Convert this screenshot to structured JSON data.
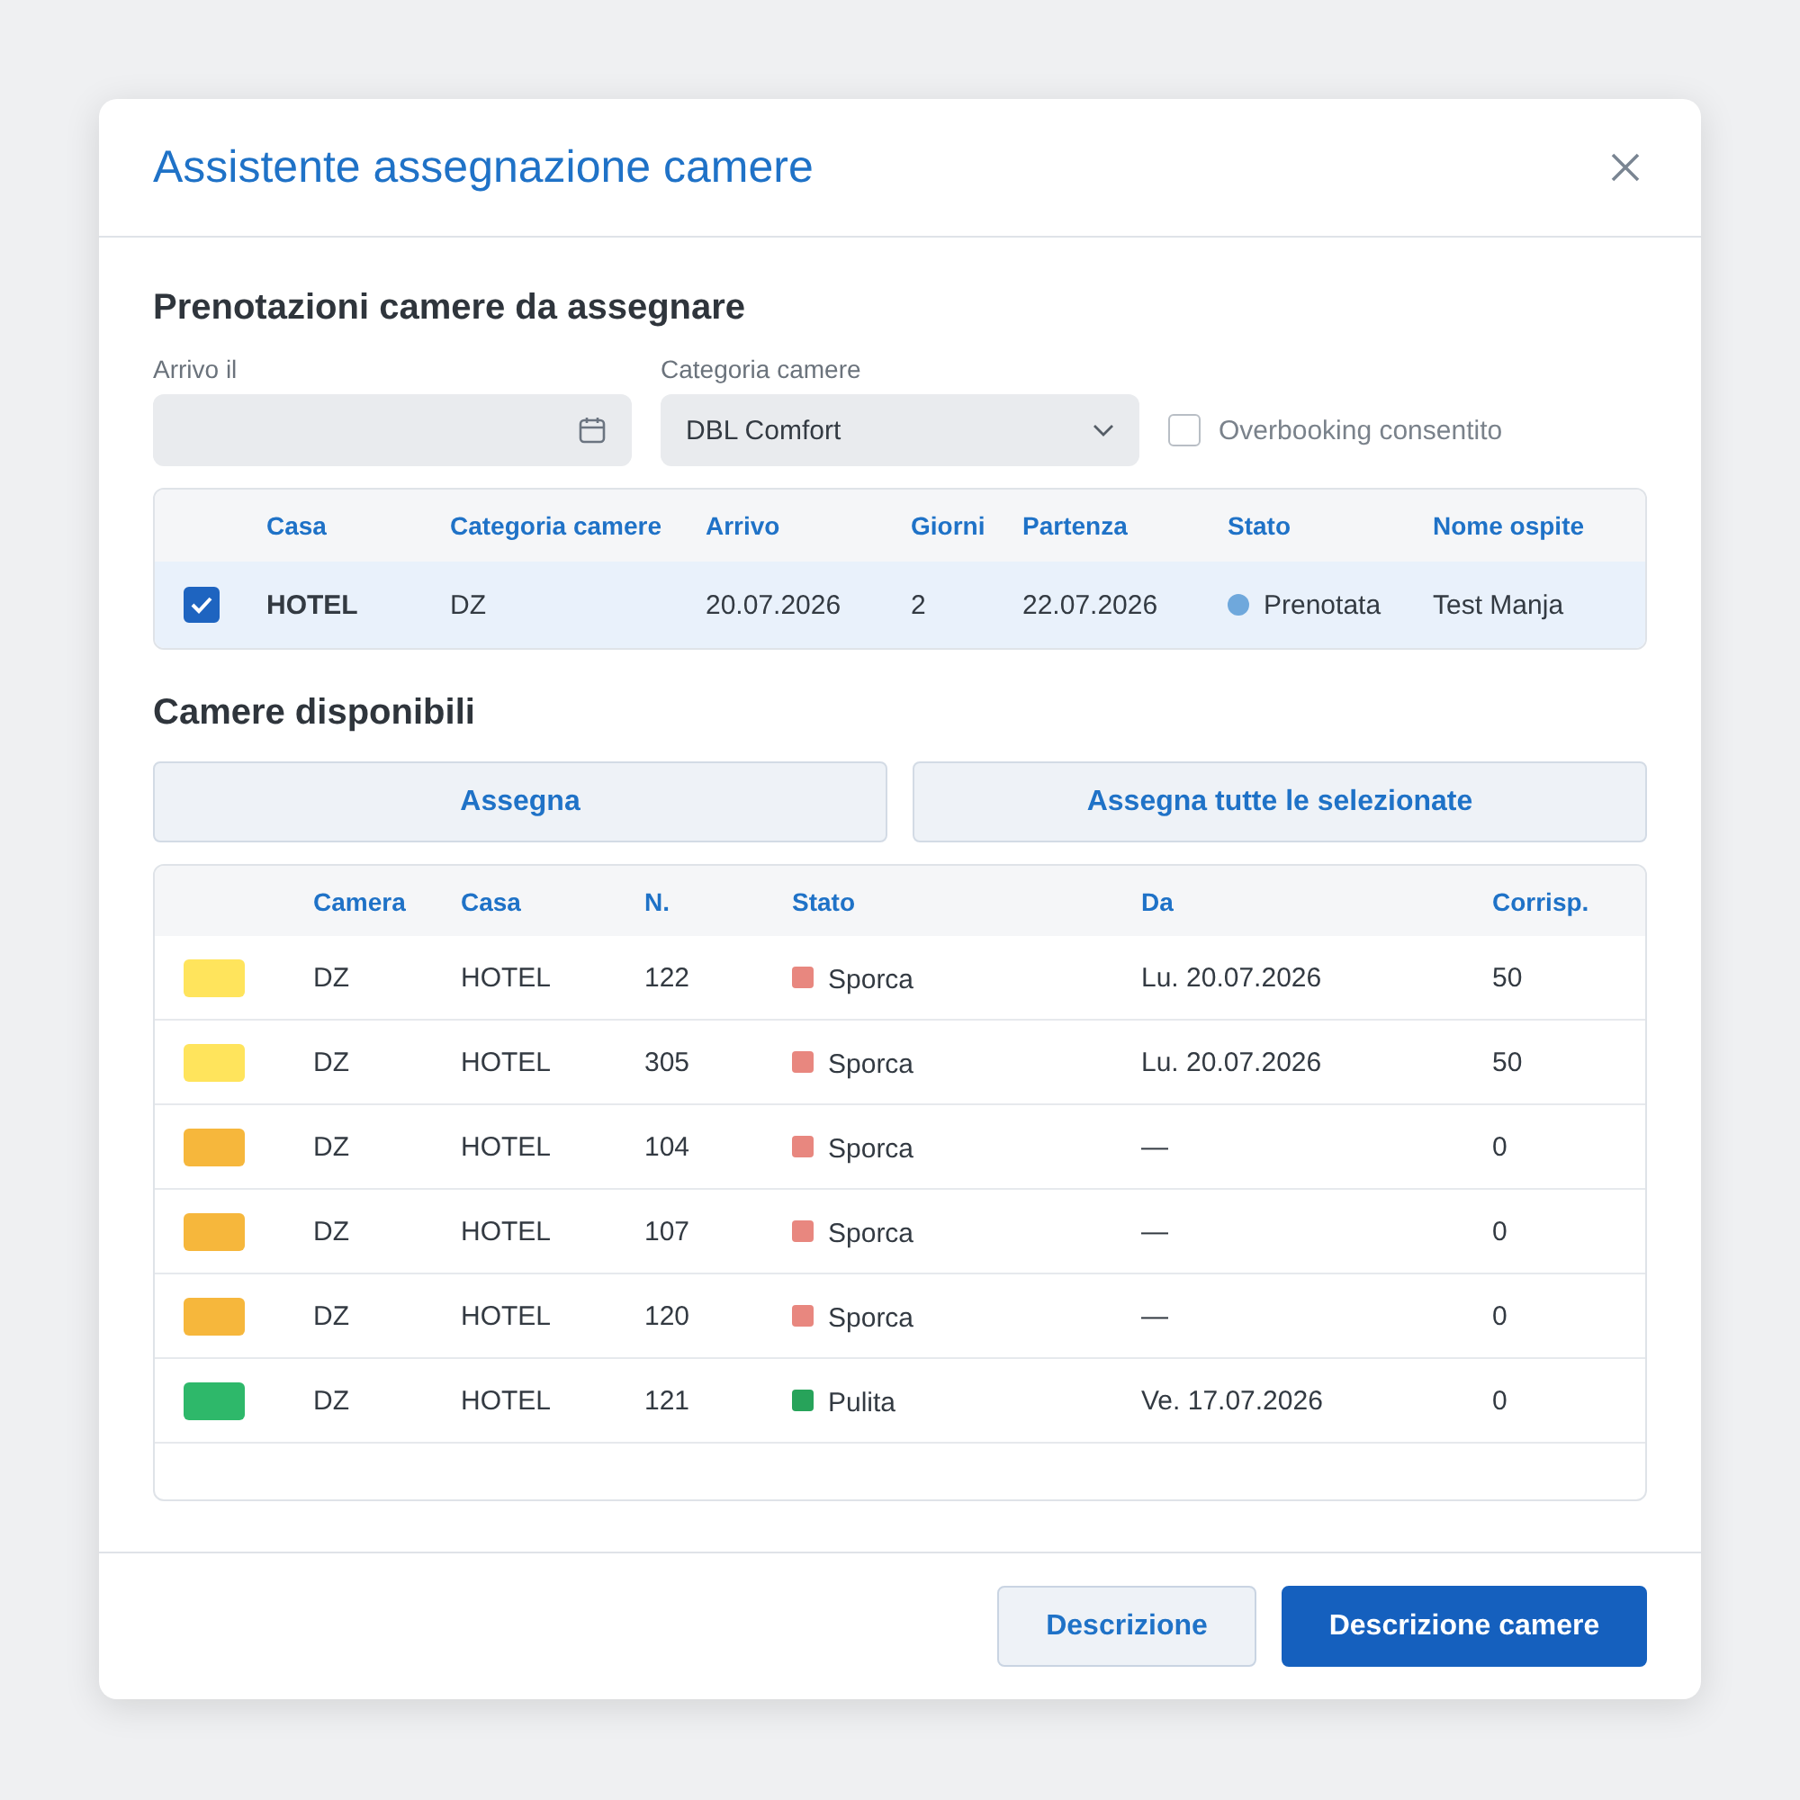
{
  "dialog": {
    "title": "Assistente assegnazione camere"
  },
  "bookings_section": {
    "title": "Prenotazioni camere da assegnare",
    "arrival_field": {
      "label": "Arrivo il"
    },
    "category_field": {
      "label": "Categoria camere",
      "value": "DBL Comfort"
    },
    "overbooking": {
      "label": "Overbooking consentito",
      "checked": false
    },
    "table": {
      "columns": [
        "Casa",
        "Categoria camere",
        "Arrivo",
        "Giorni",
        "Partenza",
        "Stato",
        "Nome ospite"
      ],
      "rows": [
        {
          "selected": true,
          "house": "HOTEL",
          "category": "DZ",
          "arrival": "20.07.2026",
          "days": "2",
          "departure": "22.07.2026",
          "status": {
            "label": "Prenotata",
            "color": "#6fa8dc"
          },
          "guest": "Test Manja"
        }
      ]
    }
  },
  "rooms_section": {
    "title": "Camere disponibili",
    "buttons": [
      "Assegna",
      "Assegna tutte le selezionate"
    ],
    "table": {
      "columns": [
        "Camera",
        "Casa",
        "N.",
        "Stato",
        "Da",
        "Corrisp."
      ],
      "rows": [
        {
          "color": "#ffe45c",
          "camera": "DZ",
          "house": "HOTEL",
          "number": "122",
          "status": {
            "label": "Sporca",
            "color": "#e8877f"
          },
          "from": "Lu. 20.07.2026",
          "match": "50"
        },
        {
          "color": "#ffe45c",
          "camera": "DZ",
          "house": "HOTEL",
          "number": "305",
          "status": {
            "label": "Sporca",
            "color": "#e8877f"
          },
          "from": "Lu. 20.07.2026",
          "match": "50"
        },
        {
          "color": "#f6b73c",
          "camera": "DZ",
          "house": "HOTEL",
          "number": "104",
          "status": {
            "label": "Sporca",
            "color": "#e8877f"
          },
          "from": "—",
          "match": "0"
        },
        {
          "color": "#f6b73c",
          "camera": "DZ",
          "house": "HOTEL",
          "number": "107",
          "status": {
            "label": "Sporca",
            "color": "#e8877f"
          },
          "from": "—",
          "match": "0"
        },
        {
          "color": "#f6b73c",
          "camera": "DZ",
          "house": "HOTEL",
          "number": "120",
          "status": {
            "label": "Sporca",
            "color": "#e8877f"
          },
          "from": "—",
          "match": "0"
        },
        {
          "color": "#2eb86a",
          "camera": "DZ",
          "house": "HOTEL",
          "number": "121",
          "status": {
            "label": "Pulita",
            "color": "#27a35a"
          },
          "from": "Ve. 17.07.2026",
          "match": "0"
        }
      ]
    }
  },
  "footer": {
    "buttons": [
      {
        "label": "Descrizione",
        "kind": "secondary"
      },
      {
        "label": "Descrizione camere",
        "kind": "primary"
      }
    ]
  }
}
